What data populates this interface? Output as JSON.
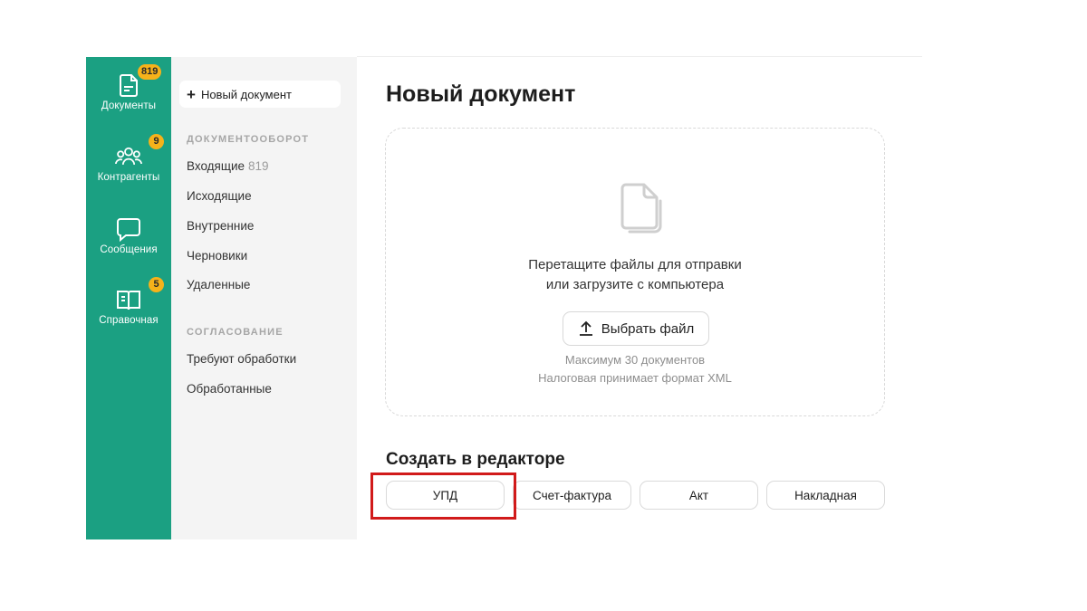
{
  "rail": {
    "items": [
      {
        "label": "Документы",
        "badge": "819",
        "icon": "document-icon"
      },
      {
        "label": "Контрагенты",
        "badge": "9",
        "icon": "contacts-icon"
      },
      {
        "label": "Сообщения",
        "badge": "",
        "icon": "message-icon"
      },
      {
        "label": "Справочная",
        "badge": "5",
        "icon": "book-icon"
      }
    ],
    "color": "#1ba082",
    "badge_color": "#f6b21a"
  },
  "sidebar": {
    "new_doc_label": "Новый документ",
    "section1_title": "ДОКУМЕНТООБОРОТ",
    "section1_items": [
      {
        "label": "Входящие",
        "count": "819"
      },
      {
        "label": "Исходящие",
        "count": ""
      },
      {
        "label": "Внутренние",
        "count": ""
      },
      {
        "label": "Черновики",
        "count": ""
      },
      {
        "label": "Удаленные",
        "count": ""
      }
    ],
    "section2_title": "СОГЛАСОВАНИЕ",
    "section2_items": [
      {
        "label": "Требуют обработки"
      },
      {
        "label": "Обработанные"
      }
    ]
  },
  "main": {
    "title": "Новый документ",
    "dropzone": {
      "line1": "Перетащите файлы для отправки",
      "line2": "или загрузите с компьютера",
      "button_label": "Выбрать файл",
      "note1": "Максимум 30 документов",
      "note2": "Налоговая принимает формат XML"
    },
    "editor_title": "Создать в редакторе",
    "editor_buttons": [
      "УПД",
      "Счет-фактура",
      "Акт",
      "Накладная"
    ],
    "highlight_color": "#d11a1a"
  }
}
